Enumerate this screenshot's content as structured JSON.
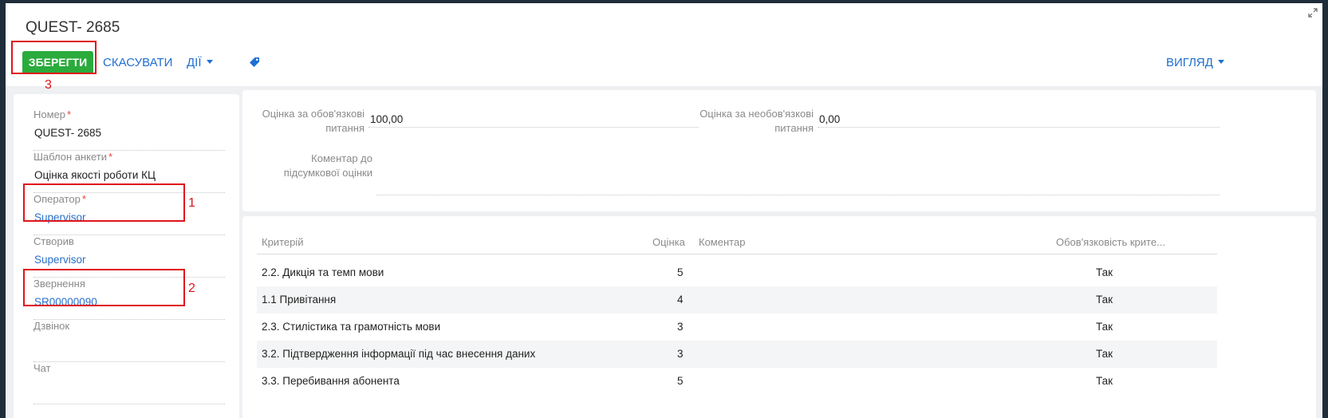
{
  "header": {
    "title": "QUEST- 2685"
  },
  "toolbar": {
    "save_label": "ЗБЕРЕГТИ",
    "cancel_label": "СКАСУВАТИ",
    "actions_label": "ДІЇ",
    "view_label": "ВИГЛЯД",
    "tag_icon": "tag-icon"
  },
  "annotations": {
    "one": "1",
    "two": "2",
    "three": "3"
  },
  "fields": {
    "number": {
      "label": "Номер",
      "value": "QUEST- 2685"
    },
    "template": {
      "label": "Шаблон анкети",
      "value": "Оцінка якості роботи КЦ"
    },
    "operator": {
      "label": "Оператор",
      "value": "Supervisor"
    },
    "created_by": {
      "label": "Створив",
      "value": "Supervisor"
    },
    "request": {
      "label": "Звернення",
      "value": "SR00000090"
    },
    "call": {
      "label": "Дзвінок",
      "value": ""
    },
    "chat": {
      "label": "Чат",
      "value": ""
    }
  },
  "scores": {
    "mandatory_label_1": "Оцінка за обов'язкові",
    "mandatory_label_2": "питання",
    "mandatory_value": "100,00",
    "optional_label_1": "Оцінка за необов'язкові",
    "optional_label_2": "питання",
    "optional_value": "0,00",
    "comment_label_1": "Коментар до",
    "comment_label_2": "підсумкової оцінки",
    "comment_value": ""
  },
  "table": {
    "columns": [
      "Критерій",
      "Оцінка",
      "Коментар",
      "Обов'язковість крите..."
    ],
    "rows": [
      {
        "criterion": "2.2. Дикція та темп мови",
        "score": "5",
        "comment": "",
        "mandatory": "Так"
      },
      {
        "criterion": "1.1 Привітання",
        "score": "4",
        "comment": "",
        "mandatory": "Так"
      },
      {
        "criterion": "2.3. Стилістика та грамотність мови",
        "score": "3",
        "comment": "",
        "mandatory": "Так"
      },
      {
        "criterion": "3.2. Підтвердження інформації під час внесення даних",
        "score": "3",
        "comment": "",
        "mandatory": "Так"
      },
      {
        "criterion": "3.3. Перебивання абонента",
        "score": "5",
        "comment": "",
        "mandatory": "Так"
      }
    ]
  },
  "colors": {
    "accent": "#1f6fd1",
    "save_button": "#2bab3c",
    "annotation": "#e0141b"
  }
}
